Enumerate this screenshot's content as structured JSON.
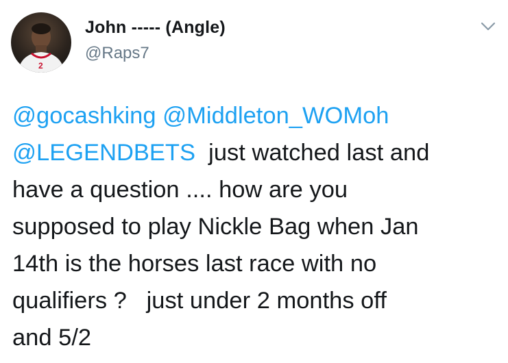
{
  "tweet": {
    "author": {
      "display_name": "John ----- (Angle)",
      "handle": "@Raps7",
      "avatar_icon": "profile-photo-basketball-player"
    },
    "menu_icon": "chevron-down-icon",
    "mentions": [
      "@gocashking",
      "@Middleton_WOMoh",
      "@LEGENDBETS"
    ],
    "body_line1_rest": "  just watched last and",
    "body_rest": "have a question .... how are you\nsupposed to play Nickle Bag when Jan\n14th is the horses last race with no\nqualifiers ?   just under 2 months off\nand 5/2"
  },
  "colors": {
    "mention": "#1da1f2",
    "text": "#14171a",
    "secondary": "#657786"
  }
}
